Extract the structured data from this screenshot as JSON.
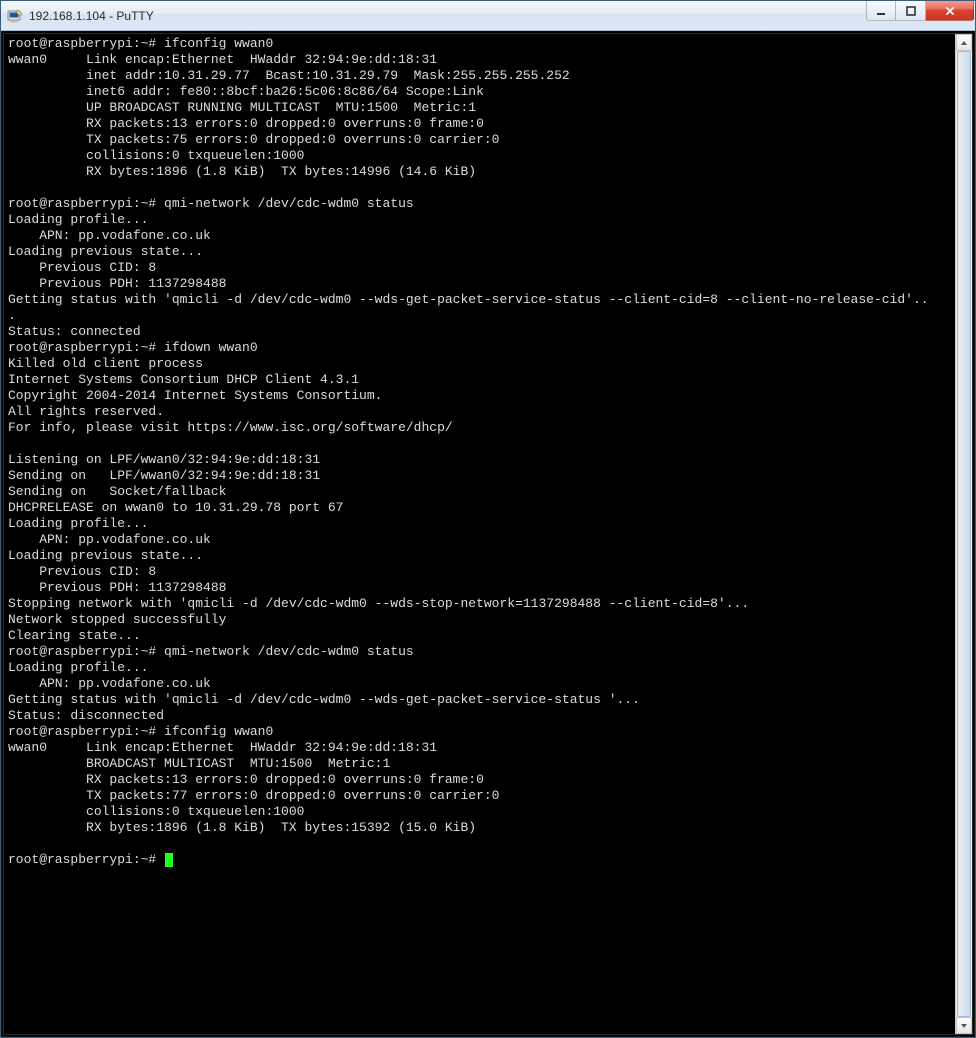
{
  "window": {
    "title": "192.168.1.104 - PuTTY"
  },
  "scrollbar": {
    "thumb_top_pct": 0,
    "thumb_height_pct": 100
  },
  "terminal": {
    "lines": [
      "root@raspberrypi:~# ifconfig wwan0",
      "wwan0     Link encap:Ethernet  HWaddr 32:94:9e:dd:18:31",
      "          inet addr:10.31.29.77  Bcast:10.31.29.79  Mask:255.255.255.252",
      "          inet6 addr: fe80::8bcf:ba26:5c06:8c86/64 Scope:Link",
      "          UP BROADCAST RUNNING MULTICAST  MTU:1500  Metric:1",
      "          RX packets:13 errors:0 dropped:0 overruns:0 frame:0",
      "          TX packets:75 errors:0 dropped:0 overruns:0 carrier:0",
      "          collisions:0 txqueuelen:1000",
      "          RX bytes:1896 (1.8 KiB)  TX bytes:14996 (14.6 KiB)",
      "",
      "root@raspberrypi:~# qmi-network /dev/cdc-wdm0 status",
      "Loading profile...",
      "    APN: pp.vodafone.co.uk",
      "Loading previous state...",
      "    Previous CID: 8",
      "    Previous PDH: 1137298488",
      "Getting status with 'qmicli -d /dev/cdc-wdm0 --wds-get-packet-service-status --client-cid=8 --client-no-release-cid'..",
      ".",
      "Status: connected",
      "root@raspberrypi:~# ifdown wwan0",
      "Killed old client process",
      "Internet Systems Consortium DHCP Client 4.3.1",
      "Copyright 2004-2014 Internet Systems Consortium.",
      "All rights reserved.",
      "For info, please visit https://www.isc.org/software/dhcp/",
      "",
      "Listening on LPF/wwan0/32:94:9e:dd:18:31",
      "Sending on   LPF/wwan0/32:94:9e:dd:18:31",
      "Sending on   Socket/fallback",
      "DHCPRELEASE on wwan0 to 10.31.29.78 port 67",
      "Loading profile...",
      "    APN: pp.vodafone.co.uk",
      "Loading previous state...",
      "    Previous CID: 8",
      "    Previous PDH: 1137298488",
      "Stopping network with 'qmicli -d /dev/cdc-wdm0 --wds-stop-network=1137298488 --client-cid=8'...",
      "Network stopped successfully",
      "Clearing state...",
      "root@raspberrypi:~# qmi-network /dev/cdc-wdm0 status",
      "Loading profile...",
      "    APN: pp.vodafone.co.uk",
      "Getting status with 'qmicli -d /dev/cdc-wdm0 --wds-get-packet-service-status '...",
      "Status: disconnected",
      "root@raspberrypi:~# ifconfig wwan0",
      "wwan0     Link encap:Ethernet  HWaddr 32:94:9e:dd:18:31",
      "          BROADCAST MULTICAST  MTU:1500  Metric:1",
      "          RX packets:13 errors:0 dropped:0 overruns:0 frame:0",
      "          TX packets:77 errors:0 dropped:0 overruns:0 carrier:0",
      "          collisions:0 txqueuelen:1000",
      "          RX bytes:1896 (1.8 KiB)  TX bytes:15392 (15.0 KiB)",
      ""
    ],
    "prompt": "root@raspberrypi:~# "
  }
}
